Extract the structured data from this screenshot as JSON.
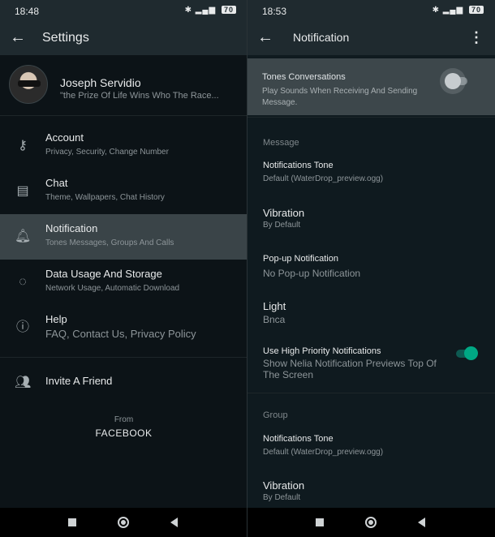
{
  "left": {
    "status_time": "18:48",
    "battery": "70",
    "title": "Settings",
    "profile": {
      "name": "Joseph Servidio",
      "status": "\"the Prize Of Life Wins Who The Race..."
    },
    "items": [
      {
        "label": "Account",
        "sub": "Privacy, Security, Change Number"
      },
      {
        "label": "Chat",
        "sub": "Theme, Wallpapers, Chat History"
      },
      {
        "label": "Notification",
        "sub": "Tones Messages, Groups And Calls"
      },
      {
        "label": "Data Usage And Storage",
        "sub": "Network Usage, Automatic Download"
      },
      {
        "label": "Help",
        "sub": "FAQ, Contact Us, Privacy Policy"
      },
      {
        "label": "Invite A Friend"
      }
    ],
    "from": "From",
    "company": "FACEBOOK"
  },
  "right": {
    "status_time": "18:53",
    "battery": "70",
    "title": "Notification",
    "tones": {
      "label": "Tones Conversations",
      "desc": "Play Sounds When Receiving And Sending Message."
    },
    "sections": {
      "message": "Message",
      "group": "Group"
    },
    "message": {
      "tone": {
        "label": "Notifications Tone",
        "value": "Default (WaterDrop_preview.ogg)"
      },
      "vibration": {
        "label": "Vibration",
        "value": "By Default"
      },
      "popup": {
        "label": "Pop-up Notification",
        "value": "No Pop-up Notification"
      },
      "light": {
        "label": "Light",
        "value": "Bnca"
      },
      "high_priority": {
        "label": "Use High Priority Notifications",
        "desc": "Show Nelia Notification Previews Top Of The Screen"
      }
    },
    "group": {
      "tone": {
        "label": "Notifications Tone",
        "value": "Default (WaterDrop_preview.ogg)"
      },
      "vibration": {
        "label": "Vibration",
        "value": "By Default"
      }
    }
  },
  "colors": {
    "accent": "#00a884",
    "appbar": "#1f2a2f",
    "background": "#0c1317",
    "selected": "#3a4448"
  },
  "icons": [
    "back-arrow-icon",
    "key-icon",
    "chat-icon",
    "bell-icon",
    "data-usage-icon",
    "help-icon",
    "people-icon",
    "more-vert-icon"
  ]
}
